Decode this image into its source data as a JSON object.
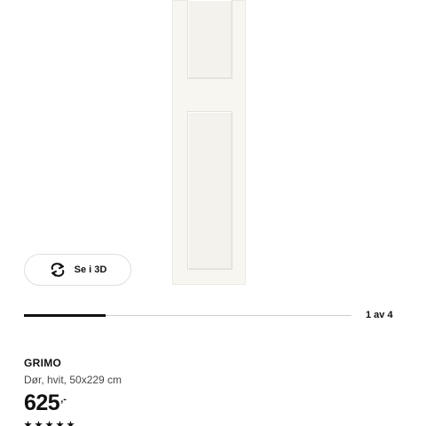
{
  "gallery": {
    "view_3d_label": "Se i 3D",
    "view_3d_icon": "rotate-3d-icon",
    "counter": "1 av 4",
    "current_image": 1,
    "total_images": 4,
    "progress_fraction": 0.25
  },
  "product": {
    "name": "GRIMO",
    "description": "Dør, hvit, 50x229 cm",
    "price_integer": "625",
    "price_decimal": ",-",
    "rating_stars": 5
  },
  "colors": {
    "text": "#111111",
    "secondary_text": "#484848",
    "track": "#cfcfcf",
    "door": "#f7f6f1"
  }
}
